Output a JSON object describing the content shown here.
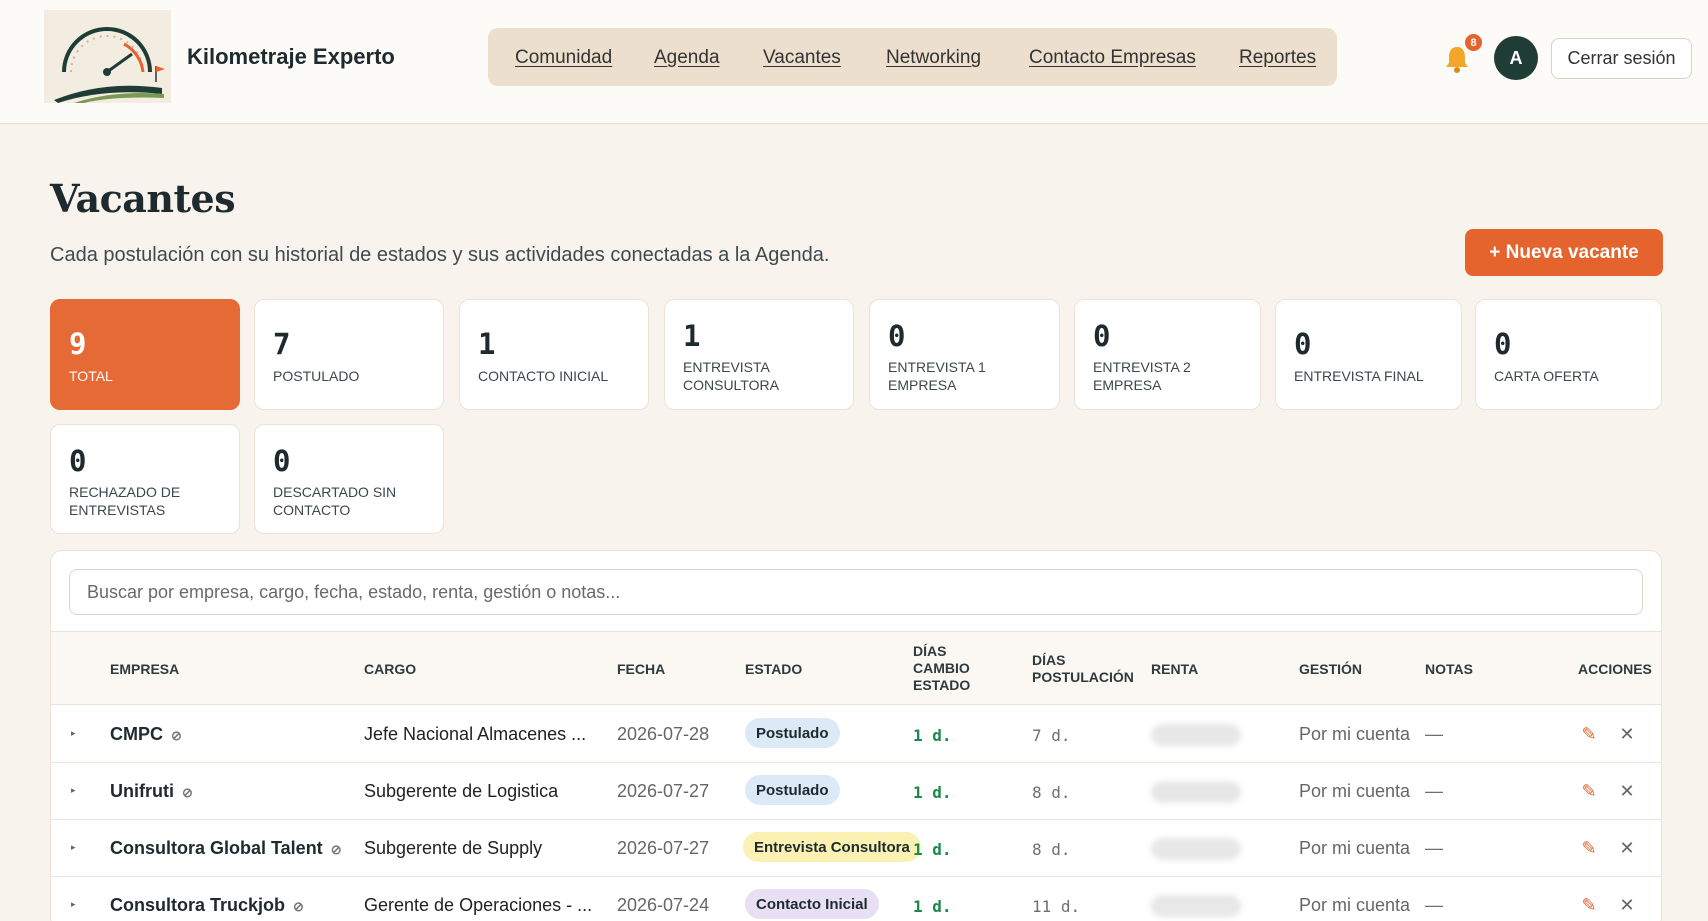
{
  "header": {
    "brand": "Kilometraje Experto",
    "nav": [
      "Comunidad",
      "Agenda",
      "Vacantes",
      "Networking",
      "Contacto Empresas",
      "Reportes"
    ],
    "notifications_count": "8",
    "avatar_initial": "A",
    "logout_label": "Cerrar sesión",
    "icons": {
      "bell": "bell-icon"
    }
  },
  "page": {
    "title": "Vacantes",
    "subtitle": "Cada postulación con su historial de estados y sus actividades conectadas a la Agenda.",
    "new_button": "+ Nueva vacante"
  },
  "stats": [
    {
      "value": "9",
      "label": "TOTAL",
      "active": true
    },
    {
      "value": "7",
      "label": "POSTULADO"
    },
    {
      "value": "1",
      "label": "CONTACTO INICIAL"
    },
    {
      "value": "1",
      "label_1": "ENTREVISTA",
      "label_2": "CONSULTORA"
    },
    {
      "value": "0",
      "label_1": "ENTREVISTA 1",
      "label_2": "EMPRESA"
    },
    {
      "value": "0",
      "label_1": "ENTREVISTA 2",
      "label_2": "EMPRESA"
    },
    {
      "value": "0",
      "label": "ENTREVISTA FINAL"
    },
    {
      "value": "0",
      "label": "CARTA OFERTA"
    },
    {
      "value": "0",
      "label_1": "RECHAZADO DE",
      "label_2": "ENTREVISTAS"
    },
    {
      "value": "0",
      "label_1": "DESCARTADO SIN",
      "label_2": "CONTACTO"
    }
  ],
  "search": {
    "placeholder": "Buscar por empresa, cargo, fecha, estado, renta, gestión o notas..."
  },
  "table": {
    "headers": {
      "empresa": "EMPRESA",
      "cargo": "CARGO",
      "fecha": "FECHA",
      "estado": "ESTADO",
      "dias_cambio_1": "DÍAS",
      "dias_cambio_2": "CAMBIO",
      "dias_cambio_3": "ESTADO",
      "dias_post_1": "DÍAS",
      "dias_post_2": "POSTULACIÓN",
      "renta": "RENTA",
      "gestion": "GESTIÓN",
      "notas": "NOTAS",
      "acciones": "ACCIONES"
    },
    "rows": [
      {
        "empresa": "CMPC",
        "cargo": "Jefe Nacional Almacenes ...",
        "fecha": "2026-07-28",
        "estado": "Postulado",
        "estado_color": "#dce9f7",
        "dias_cambio": "1 d.",
        "dias_post": "7 d.",
        "gestion": "Por mi cuenta",
        "notas": "—"
      },
      {
        "empresa": "Unifruti",
        "cargo": "Subgerente de Logistica",
        "fecha": "2026-07-27",
        "estado": "Postulado",
        "estado_color": "#dce9f7",
        "dias_cambio": "1 d.",
        "dias_post": "8 d.",
        "gestion": "Por mi cuenta",
        "notas": "—"
      },
      {
        "empresa": "Consultora Global Talent",
        "cargo": "Subgerente de Supply",
        "fecha": "2026-07-27",
        "estado": "Entrevista Consultora",
        "estado_color": "#fbf1b3",
        "dias_cambio": "1 d.",
        "dias_post": "8 d.",
        "gestion": "Por mi cuenta",
        "notas": "—"
      },
      {
        "empresa": "Consultora Truckjob",
        "cargo": "Gerente de Operaciones - ...",
        "fecha": "2026-07-24",
        "estado": "Contacto Inicial",
        "estado_color": "#e7e0f5",
        "dias_cambio": "1 d.",
        "dias_post": "11 d.",
        "gestion": "Por mi cuenta",
        "notas": "—"
      }
    ]
  },
  "colors": {
    "accent": "#e5632c",
    "background": "#f8f3ec",
    "avatar": "#1f3d34",
    "green": "#1a8a4a"
  }
}
